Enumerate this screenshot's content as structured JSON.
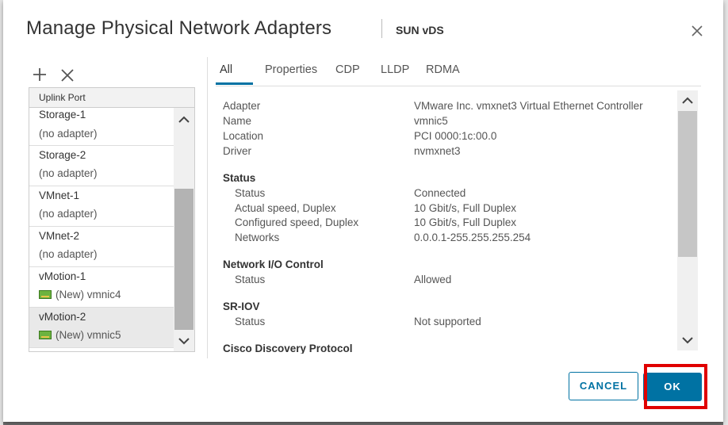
{
  "dialog": {
    "title": "Manage Physical Network Adapters",
    "subtitle": "SUN vDS"
  },
  "toolbar": {
    "add_icon": "plus-icon",
    "remove_icon": "close-icon"
  },
  "uplinks": {
    "header": "Uplink Port",
    "rows": [
      {
        "name": "Storage-1",
        "sub": "(no adapter)",
        "has_adapter": false,
        "selected": false
      },
      {
        "name": "Storage-2",
        "sub": "(no adapter)",
        "has_adapter": false,
        "selected": false
      },
      {
        "name": "VMnet-1",
        "sub": "(no adapter)",
        "has_adapter": false,
        "selected": false
      },
      {
        "name": "VMnet-2",
        "sub": "(no adapter)",
        "has_adapter": false,
        "selected": false
      },
      {
        "name": "vMotion-1",
        "sub": "(New) vmnic4",
        "has_adapter": true,
        "selected": false
      },
      {
        "name": "vMotion-2",
        "sub": "(New) vmnic5",
        "has_adapter": true,
        "selected": true
      }
    ]
  },
  "tabs": [
    {
      "label": "All",
      "active": true
    },
    {
      "label": "Properties",
      "active": false
    },
    {
      "label": "CDP",
      "active": false
    },
    {
      "label": "LLDP",
      "active": false
    },
    {
      "label": "RDMA",
      "active": false
    }
  ],
  "details": {
    "general": [
      {
        "label": "Adapter",
        "value": "VMware Inc. vmxnet3 Virtual Ethernet Controller"
      },
      {
        "label": "Name",
        "value": "vmnic5"
      },
      {
        "label": "Location",
        "value": "PCI 0000:1c:00.0"
      },
      {
        "label": "Driver",
        "value": "nvmxnet3"
      }
    ],
    "status_heading": "Status",
    "status": [
      {
        "label": "Status",
        "value": "Connected"
      },
      {
        "label": "Actual speed, Duplex",
        "value": "10 Gbit/s, Full Duplex"
      },
      {
        "label": "Configured speed, Duplex",
        "value": "10 Gbit/s, Full Duplex"
      },
      {
        "label": "Networks",
        "value": "0.0.0.1-255.255.255.254"
      }
    ],
    "nioc_heading": "Network I/O Control",
    "nioc": [
      {
        "label": "Status",
        "value": "Allowed"
      }
    ],
    "sriov_heading": "SR-IOV",
    "sriov": [
      {
        "label": "Status",
        "value": "Not supported"
      }
    ],
    "cdp_heading": "Cisco Discovery Protocol"
  },
  "buttons": {
    "cancel": "CANCEL",
    "ok": "OK"
  },
  "colors": {
    "accent": "#0072a3",
    "highlight": "#e00000",
    "nic_green": "#6cb33f"
  }
}
